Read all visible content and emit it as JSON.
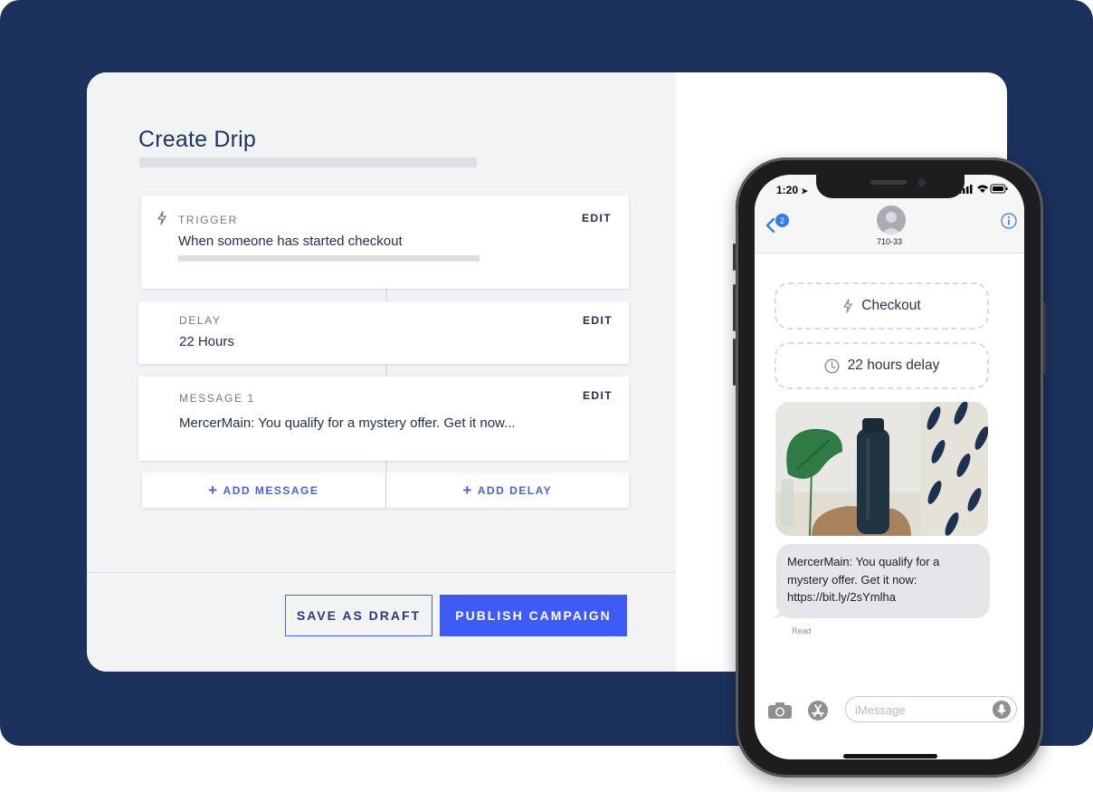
{
  "editor": {
    "title": "Create Drip",
    "steps": [
      {
        "label": "TRIGGER",
        "text": "When someone has started checkout",
        "edit": "EDIT",
        "icon": "bolt-icon"
      },
      {
        "label": "DELAY",
        "text": "22 Hours",
        "edit": "EDIT"
      },
      {
        "label": "MESSAGE 1",
        "text": "MercerMain: You qualify for a mystery offer. Get it now...",
        "edit": "EDIT"
      }
    ],
    "add_message": "ADD MESSAGE",
    "add_delay": "ADD DELAY",
    "save_draft": "SAVE AS DRAFT",
    "publish": "PUBLISH CAMPAIGN"
  },
  "phone": {
    "status_time": "1:20",
    "back_badge": "2",
    "contact": "710-33",
    "trigger_pill": "Checkout",
    "delay_pill": "22 hours delay",
    "message": "MercerMain: You qualify for a mystery offer. Get it now: https://bit.ly/2sYmlha",
    "read_status": "Read",
    "compose_placeholder": "iMessage"
  },
  "colors": {
    "background": "#1c325c",
    "accent": "#3f5bf5",
    "bubble": "#e5e5ea"
  }
}
